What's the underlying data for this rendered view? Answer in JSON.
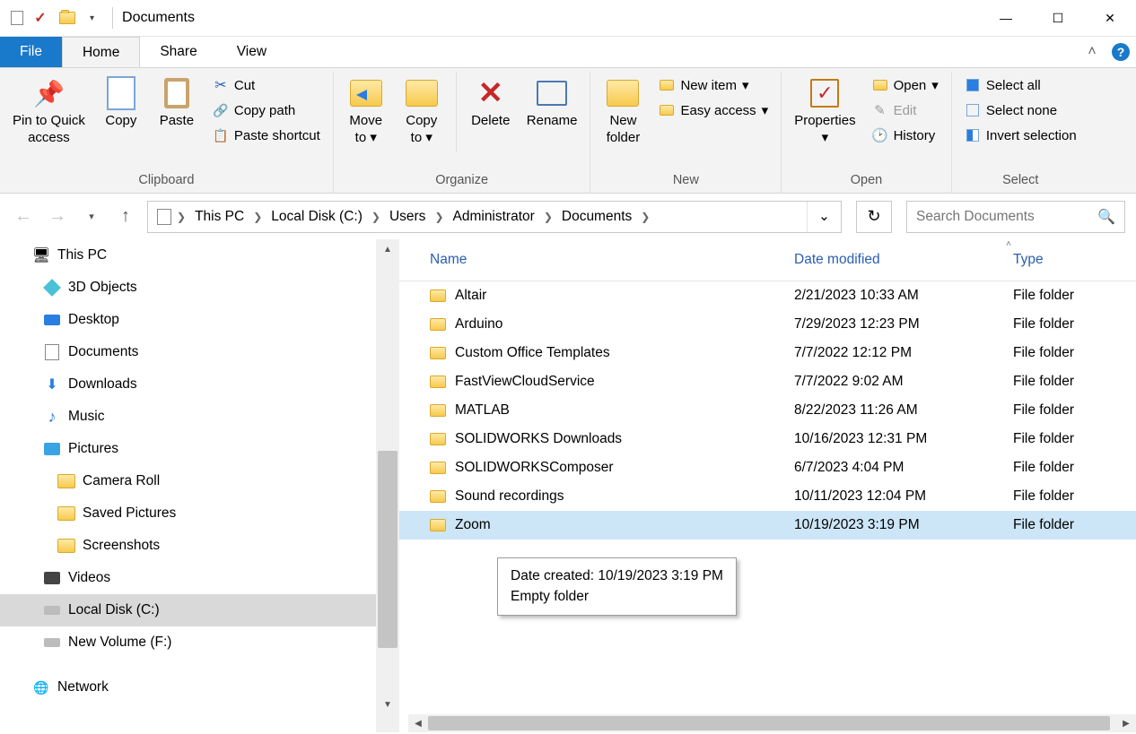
{
  "window": {
    "title": "Documents"
  },
  "tabs": {
    "file": "File",
    "home": "Home",
    "share": "Share",
    "view": "View"
  },
  "ribbon": {
    "clipboard": {
      "label": "Clipboard",
      "pin": "Pin to Quick\naccess",
      "copy": "Copy",
      "paste": "Paste",
      "cut": "Cut",
      "copy_path": "Copy path",
      "paste_shortcut": "Paste shortcut"
    },
    "organize": {
      "label": "Organize",
      "move_to": "Move\nto",
      "copy_to": "Copy\nto",
      "delete": "Delete",
      "rename": "Rename"
    },
    "new": {
      "label": "New",
      "new_folder": "New\nfolder",
      "new_item": "New item",
      "easy_access": "Easy access"
    },
    "open": {
      "label": "Open",
      "properties": "Properties",
      "open": "Open",
      "edit": "Edit",
      "history": "History"
    },
    "select": {
      "label": "Select",
      "select_all": "Select all",
      "select_none": "Select none",
      "invert": "Invert selection"
    }
  },
  "breadcrumbs": [
    "This PC",
    "Local Disk (C:)",
    "Users",
    "Administrator",
    "Documents"
  ],
  "refresh_glyph": "↻",
  "search": {
    "placeholder": "Search Documents"
  },
  "tree": [
    {
      "icon": "pc",
      "label": "This PC",
      "level": 0
    },
    {
      "icon": "cube",
      "label": "3D Objects",
      "level": 1
    },
    {
      "icon": "desktop",
      "label": "Desktop",
      "level": 1
    },
    {
      "icon": "doc",
      "label": "Documents",
      "level": 1
    },
    {
      "icon": "down",
      "label": "Downloads",
      "level": 1
    },
    {
      "icon": "music",
      "label": "Music",
      "level": 1
    },
    {
      "icon": "pic",
      "label": "Pictures",
      "level": 1
    },
    {
      "icon": "folder",
      "label": "Camera Roll",
      "level": 2
    },
    {
      "icon": "folder",
      "label": "Saved Pictures",
      "level": 2
    },
    {
      "icon": "folder",
      "label": "Screenshots",
      "level": 2
    },
    {
      "icon": "vid",
      "label": "Videos",
      "level": 1
    },
    {
      "icon": "disk",
      "label": "Local Disk (C:)",
      "level": 1,
      "selected": true
    },
    {
      "icon": "disk",
      "label": "New Volume (F:)",
      "level": 1
    },
    {
      "icon": "net",
      "label": "Network",
      "level": 0
    }
  ],
  "columns": {
    "name": "Name",
    "date": "Date modified",
    "type": "Type"
  },
  "files": [
    {
      "name": "Altair",
      "date": "2/21/2023 10:33 AM",
      "type": "File folder"
    },
    {
      "name": "Arduino",
      "date": "7/29/2023 12:23 PM",
      "type": "File folder"
    },
    {
      "name": "Custom Office Templates",
      "date": "7/7/2022 12:12 PM",
      "type": "File folder"
    },
    {
      "name": "FastViewCloudService",
      "date": "7/7/2022 9:02 AM",
      "type": "File folder"
    },
    {
      "name": "MATLAB",
      "date": "8/22/2023 11:26 AM",
      "type": "File folder"
    },
    {
      "name": "SOLIDWORKS Downloads",
      "date": "10/16/2023 12:31 PM",
      "type": "File folder"
    },
    {
      "name": "SOLIDWORKSComposer",
      "date": "6/7/2023 4:04 PM",
      "type": "File folder"
    },
    {
      "name": "Sound recordings",
      "date": "10/11/2023 12:04 PM",
      "type": "File folder"
    },
    {
      "name": "Zoom",
      "date": "10/19/2023 3:19 PM",
      "type": "File folder",
      "selected": true
    }
  ],
  "tooltip": {
    "line1": "Date created: 10/19/2023 3:19 PM",
    "line2": "Empty folder"
  }
}
